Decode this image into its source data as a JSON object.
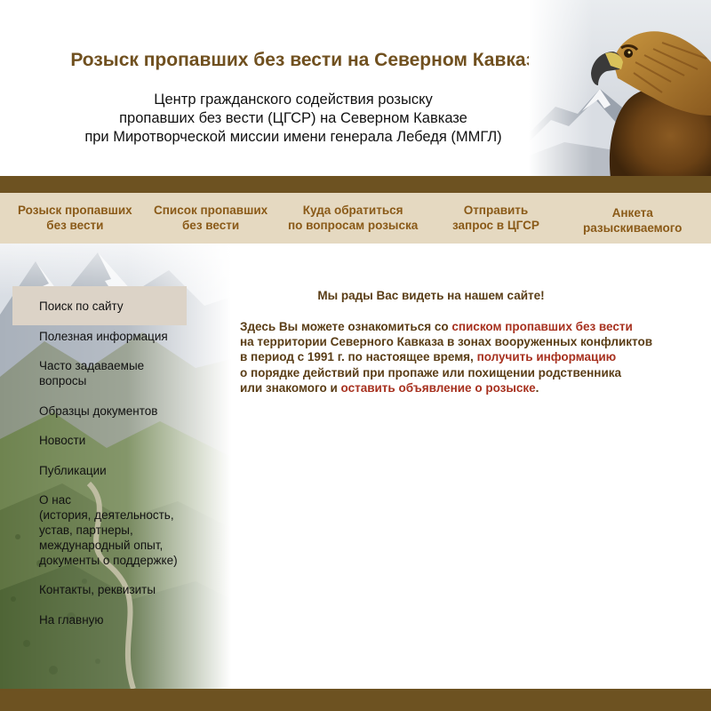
{
  "header": {
    "title": "Розыск пропавших без вести на Северном Кавказе",
    "description_lines": [
      "Центр гражданского содействия розыску",
      "пропавших без вести (ЦГСР) на Северном Кавказе",
      "при Миротворческой миссии имени генерала Лебедя (ММГЛ)"
    ]
  },
  "nav": {
    "items": [
      {
        "line1": "Розыск пропавших",
        "line2": "без вести"
      },
      {
        "line1": "Список пропавших",
        "line2": "без вести"
      },
      {
        "line1": "Куда обратиться",
        "line2": "по вопросам розыска"
      },
      {
        "line1": "Отправить",
        "line2": "запрос в ЦГСР"
      },
      {
        "line1": "Анкета",
        "line2": "разыскиваемого"
      }
    ]
  },
  "sidebar": {
    "items": [
      {
        "label": "Поиск по сайту"
      },
      {
        "label": "Полезная информация"
      },
      {
        "line1": "Часто задаваемые",
        "line2": "вопросы"
      },
      {
        "label": "Образцы документов"
      },
      {
        "label": "Новости"
      },
      {
        "label": "Публикации"
      },
      {
        "lines": [
          "О нас",
          "(история, деятельность,",
          " устав, партнеры,",
          " международный опыт,",
          "документы о поддержке)"
        ]
      },
      {
        "label": "Контакты, реквизиты"
      },
      {
        "label": "На главную"
      }
    ]
  },
  "content": {
    "welcome": "Мы рады Вас видеть на нашем сайте!",
    "intro": {
      "p1": "Здесь Вы можете ознакомиться со ",
      "link1": "списком пропавших без вести",
      "p2": "на территории Северного Кавказа в зонах вооруженных конфликтов",
      "p3": "в период с 1991 г.  по настоящее время, ",
      "link2": "получить информацию",
      "p4": "о порядке действий при пропаже или похищении родственника",
      "p5": "или знакомого и ",
      "link3": "оставить объявление о розыске",
      "p6": "."
    }
  },
  "colors": {
    "bar_brown": "#6d5221",
    "nav_bg": "#e5d9c1",
    "nav_text": "#8a5a18",
    "title_brown": "#70501f",
    "content_text": "#5a3d16",
    "link_red": "#a7311f",
    "menu_active_bg": "#dcd3c7"
  },
  "images": {
    "header": "eagle-head-over-snowy-mountains",
    "sidebar": "mountain-valley-landscape-fading"
  }
}
